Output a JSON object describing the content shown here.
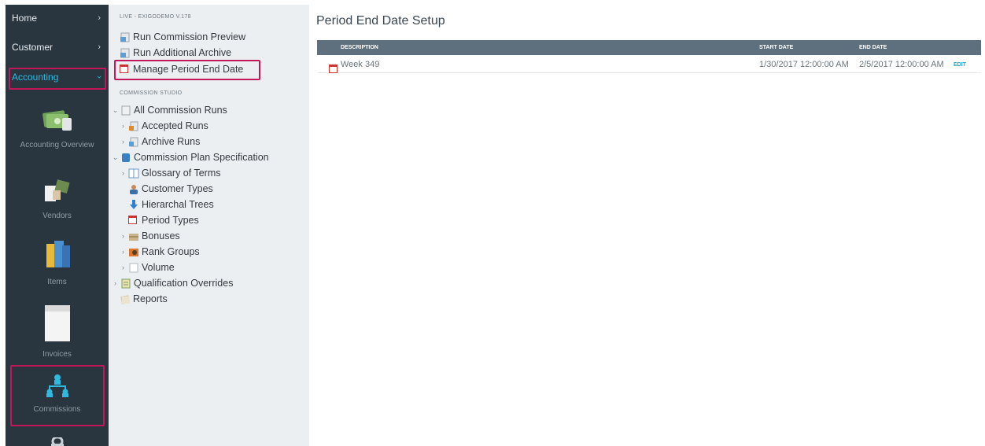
{
  "sidebar": {
    "nav": [
      {
        "label": "Home"
      },
      {
        "label": "Customer"
      },
      {
        "label": "Accounting"
      }
    ],
    "modules": [
      {
        "label": "Accounting Overview",
        "icon": "money-stack-icon"
      },
      {
        "label": "Vendors",
        "icon": "vendors-icon"
      },
      {
        "label": "Items",
        "icon": "items-books-icon"
      },
      {
        "label": "Invoices",
        "icon": "invoice-document-icon"
      },
      {
        "label": "Commissions",
        "icon": "org-hierarchy-icon"
      }
    ]
  },
  "tree": {
    "env_label": "LIVE - EXIGODEMO V.178",
    "top_items": [
      {
        "label": "Run Commission Preview",
        "icon": "preview-doc-icon"
      },
      {
        "label": "Run Additional Archive",
        "icon": "archive-doc-icon"
      },
      {
        "label": "Manage Period End Date",
        "icon": "calendar-icon"
      }
    ],
    "section_label": "COMMISSION STUDIO",
    "items": [
      {
        "label": "All Commission Runs",
        "icon": "document-icon"
      },
      {
        "label": "Accepted Runs",
        "icon": "accepted-runs-icon"
      },
      {
        "label": "Archive Runs",
        "icon": "archive-runs-icon"
      },
      {
        "label": "Commission Plan Specification",
        "icon": "book-icon"
      },
      {
        "label": "Glossary of Terms",
        "icon": "glossary-icon"
      },
      {
        "label": "Customer Types",
        "icon": "user-icon"
      },
      {
        "label": "Hierarchal Trees",
        "icon": "down-arrow-icon"
      },
      {
        "label": "Period Types",
        "icon": "calendar-icon"
      },
      {
        "label": "Bonuses",
        "icon": "bonuses-icon"
      },
      {
        "label": "Rank Groups",
        "icon": "rank-groups-icon"
      },
      {
        "label": "Volume",
        "icon": "volume-icon"
      },
      {
        "label": "Qualification Overrides",
        "icon": "qualification-icon"
      },
      {
        "label": "Reports",
        "icon": "reports-icon"
      }
    ]
  },
  "main": {
    "title": "Period End Date Setup",
    "table": {
      "columns": [
        "DESCRIPTION",
        "START DATE",
        "END DATE"
      ],
      "rows": [
        {
          "description": "Week 349",
          "start": "1/30/2017 12:00:00 AM",
          "end": "2/5/2017 12:00:00 AM",
          "action": "EDIT"
        }
      ]
    }
  },
  "colors": {
    "sidebar_bg": "#2a363f",
    "highlight": "#c2185b",
    "accent": "#2fb8e0",
    "table_header": "#5e707d"
  }
}
